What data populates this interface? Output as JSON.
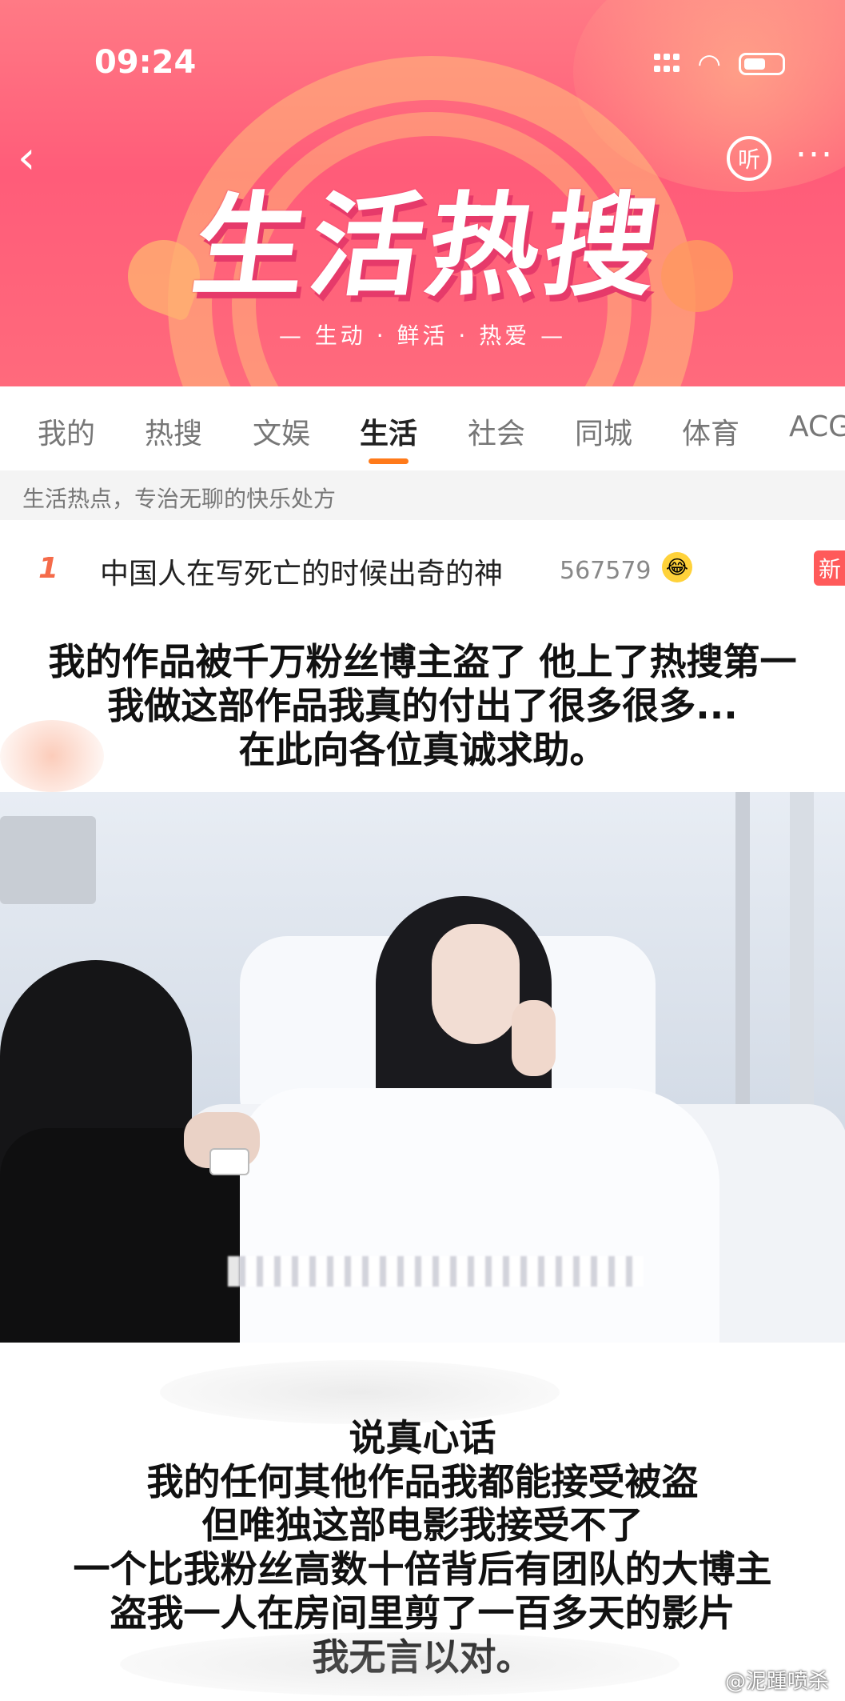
{
  "status_bar": {
    "time": "09:24"
  },
  "header": {
    "back_label": "‹",
    "listen_label": "听",
    "more_label": "···",
    "title": "生活热搜",
    "subtitle": "— 生动 · 鲜活 · 热爱 —"
  },
  "tabs": [
    {
      "label": "我的"
    },
    {
      "label": "热搜"
    },
    {
      "label": "文娱"
    },
    {
      "label": "生活"
    },
    {
      "label": "社会"
    },
    {
      "label": "同城"
    },
    {
      "label": "体育"
    },
    {
      "label": "ACG"
    }
  ],
  "active_tab": "生活",
  "description": "生活热点，专治无聊的快乐处方",
  "hot_item": {
    "rank": "1",
    "text": "中国人在写死亡的时候出奇的神",
    "count": "567579",
    "badge": "新"
  },
  "caption_top": "我的作品被千万粉丝博主盗了 他上了热搜第一\n我做这部作品我真的付出了很多很多...\n在此向各位真诚求助。",
  "caption_bottom": "说真心话\n我的任何其他作品我都能接受被盗\n但唯独这部电影我接受不了\n一个比我粉丝高数十倍背后有团队的大博主\n盗我一人在房间里剪了一百多天的影片\n我无言以对。",
  "watermark": "@泥踵喷杀"
}
